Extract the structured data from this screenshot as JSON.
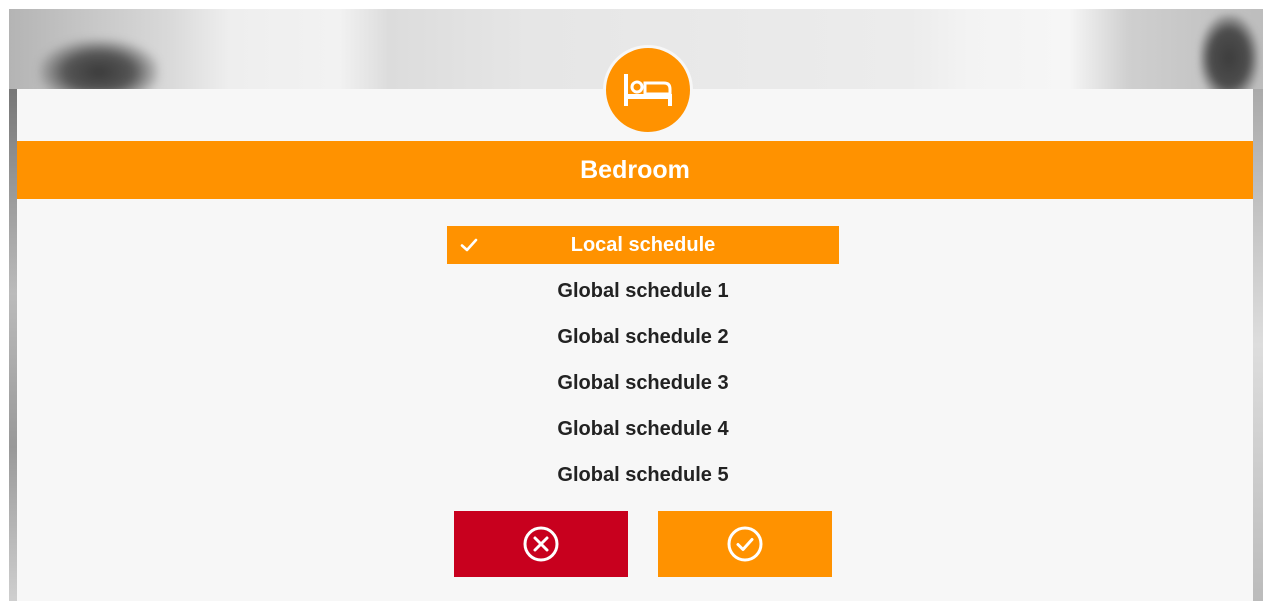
{
  "dialog": {
    "title": "Bedroom",
    "room_icon": "bed-icon",
    "options": [
      {
        "label": "Local schedule",
        "selected": true
      },
      {
        "label": "Global schedule 1",
        "selected": false
      },
      {
        "label": "Global schedule 2",
        "selected": false
      },
      {
        "label": "Global schedule 3",
        "selected": false
      },
      {
        "label": "Global schedule 4",
        "selected": false
      },
      {
        "label": "Global schedule 5",
        "selected": false
      }
    ],
    "buttons": {
      "cancel_icon": "close-circle-icon",
      "confirm_icon": "check-circle-icon"
    }
  },
  "colors": {
    "accent": "#ff9200",
    "cancel": "#c8001e",
    "dialog_background": "#f7f7f7",
    "text": "#222222"
  }
}
